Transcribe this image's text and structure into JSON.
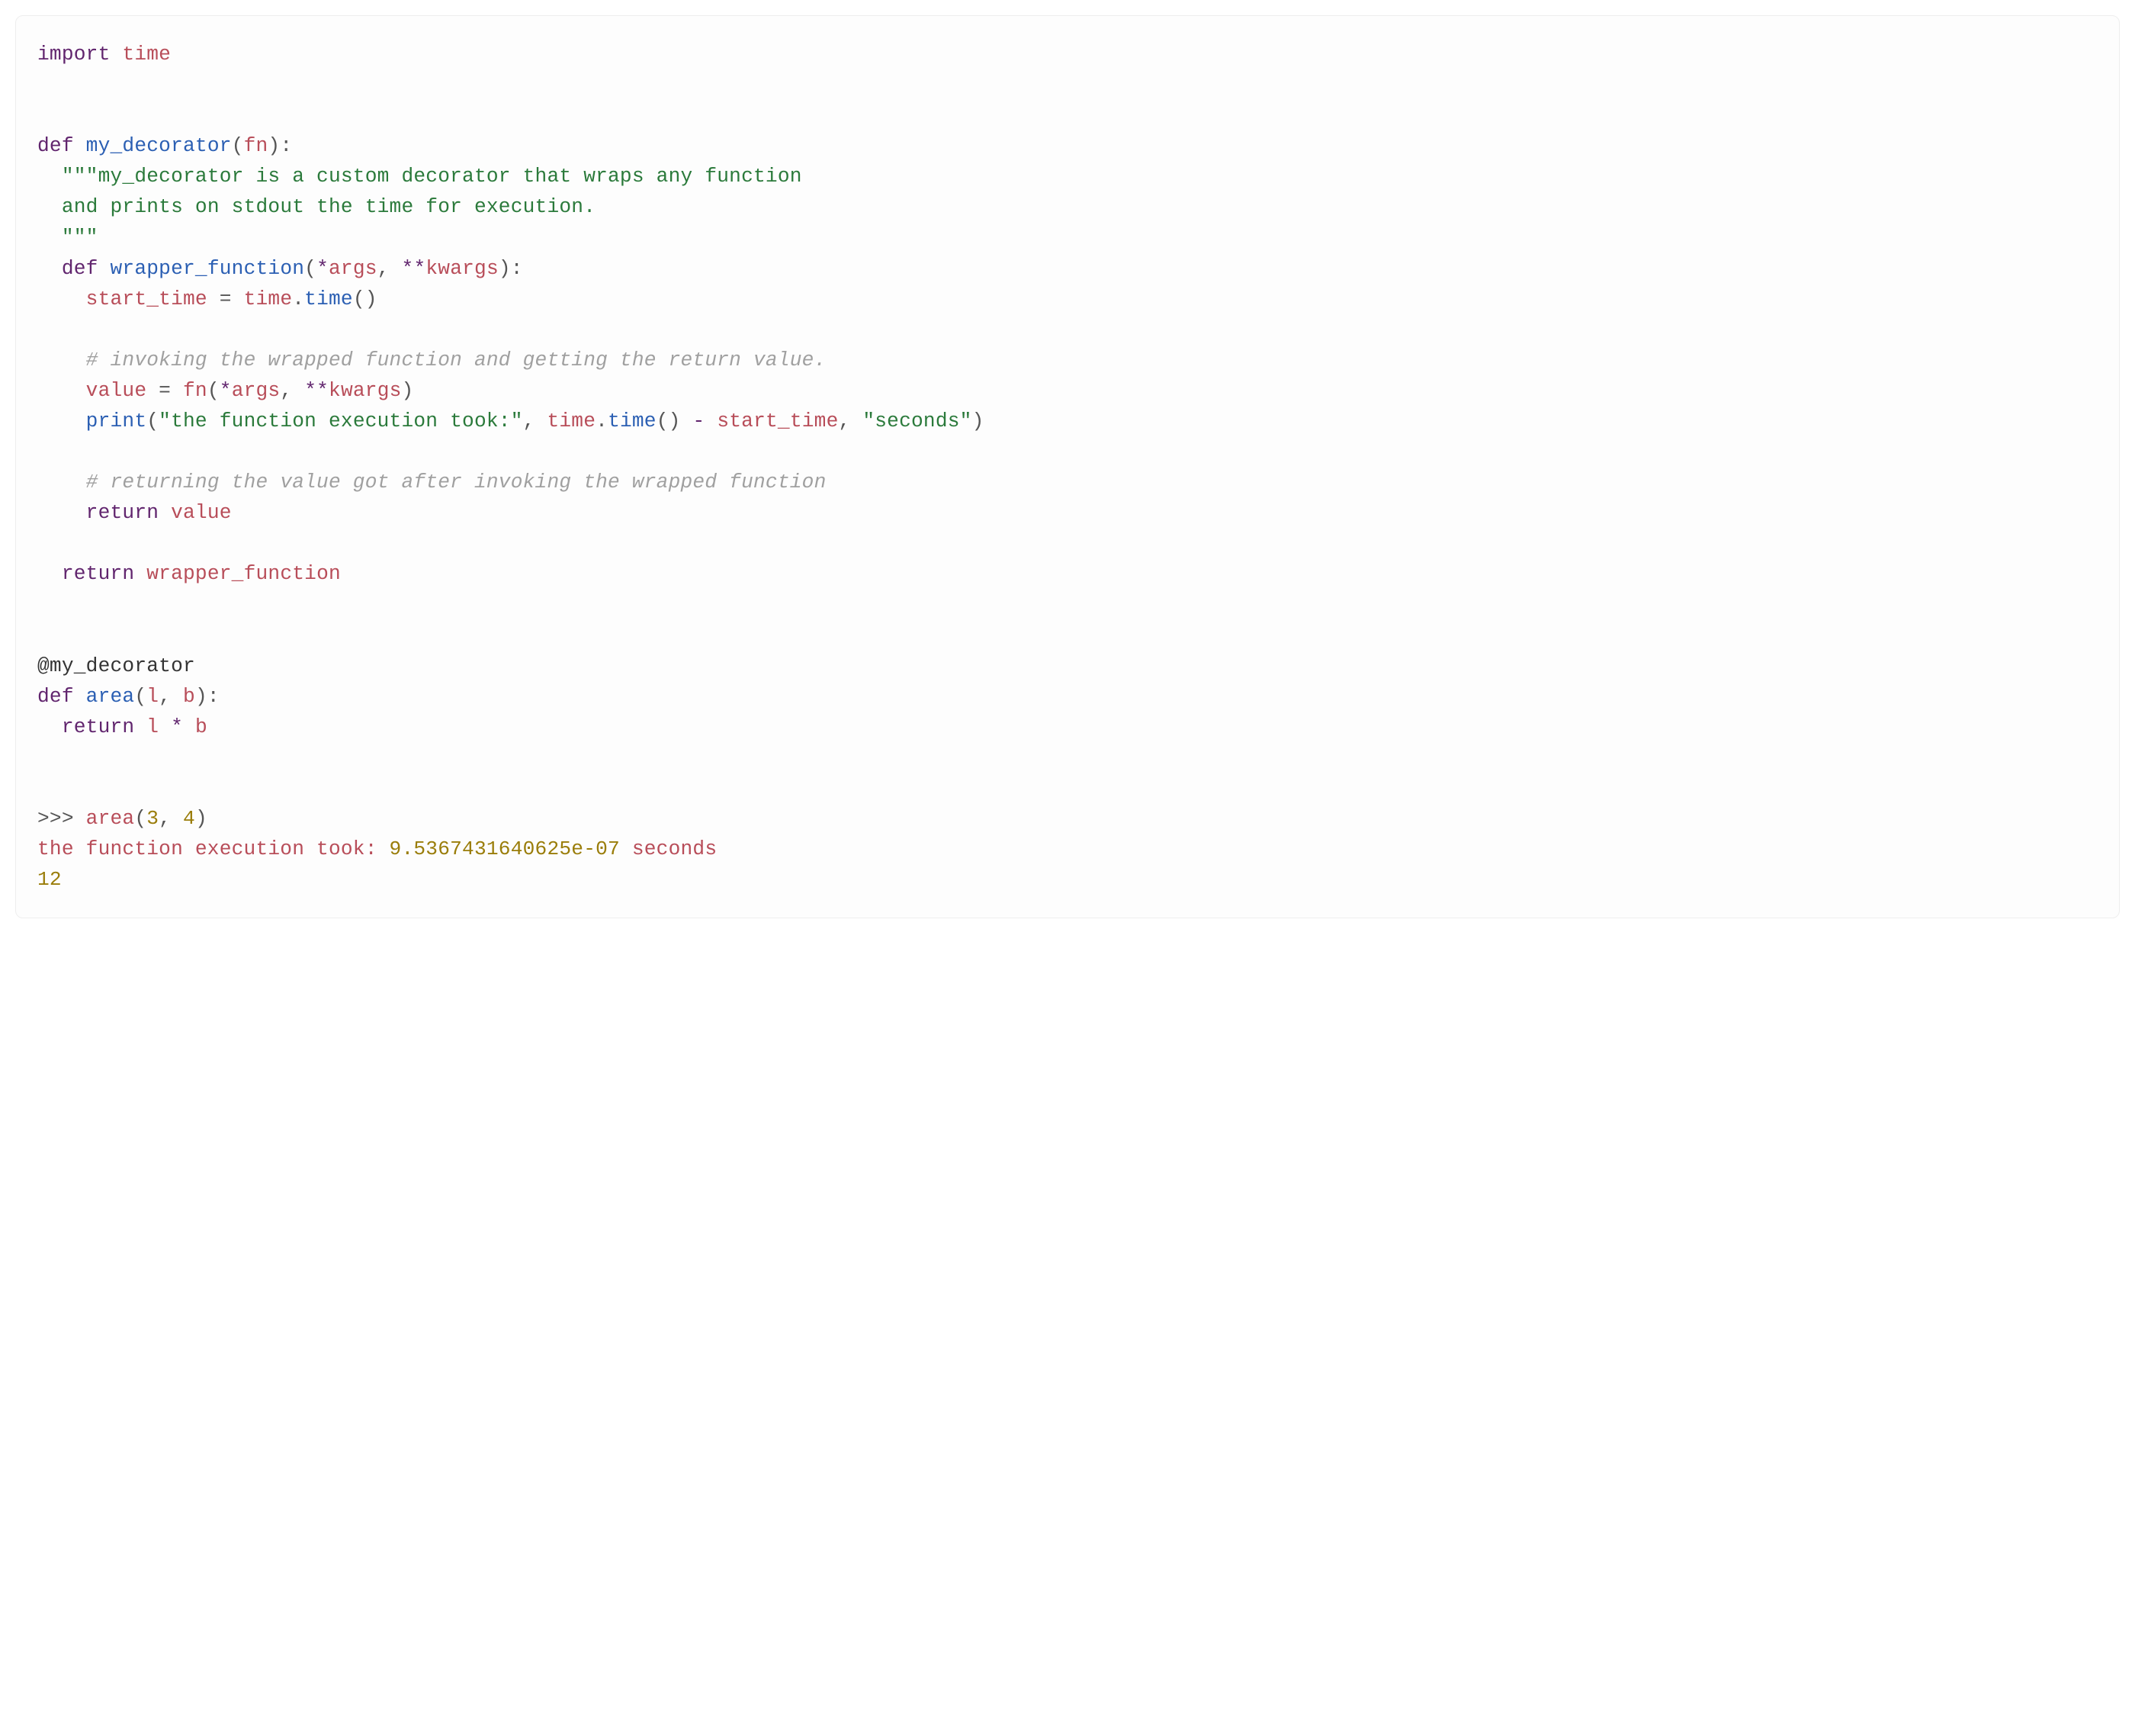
{
  "code": {
    "l1_import": "import",
    "l1_time": "time",
    "l3_def": "def",
    "l3_name": "my_decorator",
    "l3_paren_open": "(",
    "l3_param": "fn",
    "l3_paren_close_colon": "):",
    "l4_doc1": "\"\"\"my_decorator is a custom decorator that wraps any function",
    "l5_doc2": "and prints on stdout the time for execution.",
    "l6_doc3": "\"\"\"",
    "l7_def": "def",
    "l7_name": "wrapper_function",
    "l7_paren_open": "(",
    "l7_star": "*",
    "l7_args": "args",
    "l7_comma": ", ",
    "l7_dstar": "**",
    "l7_kwargs": "kwargs",
    "l7_paren_close_colon": "):",
    "l8_start_time": "start_time",
    "l8_eq": " = ",
    "l8_time1": "time",
    "l8_dot": ".",
    "l8_time2": "time",
    "l8_parens": "()",
    "l10_comment": "# invoking the wrapped function and getting the return value.",
    "l11_value": "value",
    "l11_eq": " = ",
    "l11_fn": "fn",
    "l11_paren_open": "(",
    "l11_star": "*",
    "l11_args": "args",
    "l11_comma": ", ",
    "l11_dstar": "**",
    "l11_kwargs": "kwargs",
    "l11_paren_close": ")",
    "l12_print": "print",
    "l12_paren_open": "(",
    "l12_str1": "\"the function execution took:\"",
    "l12_comma1": ", ",
    "l12_time1": "time",
    "l12_dot": ".",
    "l12_time2": "time",
    "l12_parens": "()",
    "l12_sp_minus_sp": " - ",
    "l12_minus": "-",
    "l12_start_time": "start_time",
    "l12_comma2": ", ",
    "l12_str2": "\"seconds\"",
    "l12_paren_close": ")",
    "l14_comment": "# returning the value got after invoking the wrapped function",
    "l15_return": "return",
    "l15_value": "value",
    "l17_return": "return",
    "l17_wrapper": "wrapper_function",
    "l20_deco": "@my_decorator",
    "l21_def": "def",
    "l21_name": "area",
    "l21_paren_open": "(",
    "l21_l": "l",
    "l21_comma": ", ",
    "l21_b": "b",
    "l21_paren_close_colon": "):",
    "l22_return": "return",
    "l22_l": "l",
    "l22_star": " * ",
    "l22_starchar": "*",
    "l22_b": "b",
    "l25_prompt": ">>> ",
    "l25_area": "area",
    "l25_paren_open": "(",
    "l25_3": "3",
    "l25_comma": ", ",
    "l25_4": "4",
    "l25_paren_close": ")",
    "l26_pref": "the function execution took: ",
    "l26_num": "9.5367431640625e-07",
    "l26_suf": " seconds",
    "l27_12": "12"
  }
}
